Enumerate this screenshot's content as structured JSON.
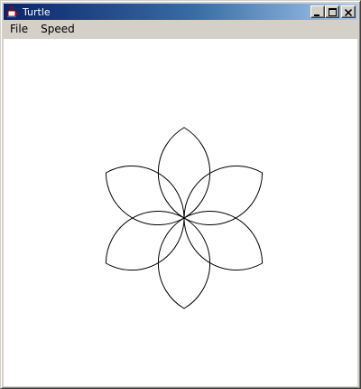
{
  "window": {
    "title": "Turtle",
    "icon": "java-cup-icon",
    "controls": {
      "minimize_icon": "minimize-icon",
      "maximize_icon": "maximize-icon",
      "close_icon": "close-icon"
    }
  },
  "menu": {
    "items": [
      {
        "label": "File"
      },
      {
        "label": "Speed"
      }
    ]
  },
  "drawing": {
    "shape": "six-petal rosette of circular arcs",
    "petal_count": 6,
    "stroke_color": "#000000",
    "background_color": "#ffffff"
  },
  "colors": {
    "titlebar_start": "#0a246a",
    "titlebar_end": "#a6caf0",
    "chrome": "#d4d0c8"
  }
}
